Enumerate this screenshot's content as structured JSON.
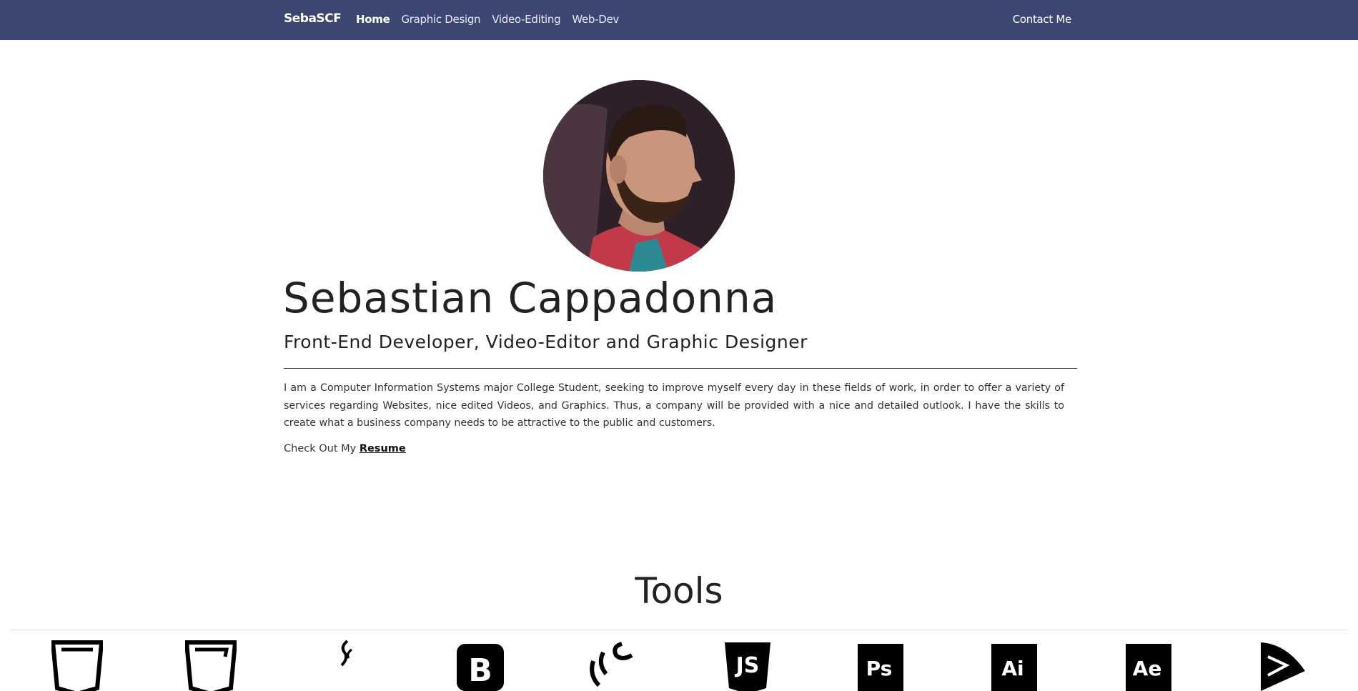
{
  "nav": {
    "brand": "SebaSCF",
    "links": [
      "Home",
      "Graphic Design",
      "Video-Editing",
      "Web-Dev"
    ],
    "contact": "Contact Me"
  },
  "profile": {
    "name": "Sebastian Cappadonna",
    "subtitle": "Front-End Developer, Video-Editor and Graphic Designer",
    "intro": "I am a Computer Information Systems major College Student, seeking to improve myself every day in these fields of work, in order to offer a variety of services regarding Websites, nice edited Videos, and Graphics. Thus, a company will be provided with a nice and detailed outlook. I have the skills to create what a business company needs to be attractive to the public and customers.",
    "resume_prefix": "Check Out My",
    "resume_link": "Resume"
  },
  "tools": {
    "title": "Tools",
    "icons": [
      "html5-icon",
      "css3-icon",
      "java-icon",
      "bootstrap-icon",
      "jquery-icon",
      "javascript-icon",
      "photoshop-icon",
      "illustrator-icon",
      "after-effects-icon",
      "premiere-icon"
    ]
  },
  "colors": {
    "navbar": "#3b4672",
    "text": "#222222"
  }
}
